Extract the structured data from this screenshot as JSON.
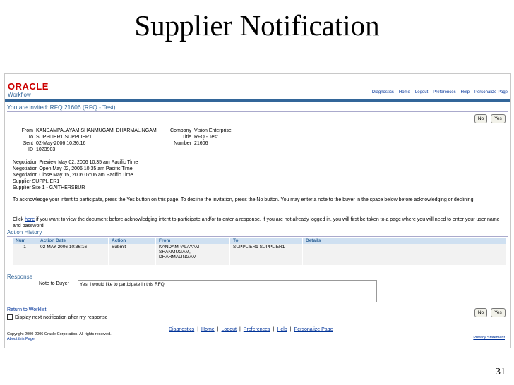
{
  "slide": {
    "title": "Supplier Notification",
    "number": "31"
  },
  "header": {
    "logo": "ORACLE",
    "brand": "Workflow",
    "links": [
      "Diagnostics",
      "Home",
      "Logout",
      "Preferences",
      "Help",
      "Personalize Page"
    ]
  },
  "page": {
    "title": "You are invited: RFQ 21606 (RFQ - Test)",
    "no_label": "No",
    "yes_label": "Yes"
  },
  "fields": {
    "from_label": "From",
    "from_value": "KANDAMPALAYAM SHANMUGAM, DHARMALINGAM",
    "to_label": "To",
    "to_value": "SUPPLIER1 SUPPLIER1",
    "sent_label": "Sent",
    "sent_value": "02-May-2006 10:36:16",
    "id_label": "ID",
    "id_value": "1023903",
    "company_label": "Company",
    "company_value": "Vision Enterprise",
    "title_label": "Title",
    "title_value": "RFQ - Test",
    "number_label": "Number",
    "number_value": "21606"
  },
  "negotiation": [
    "Negotiation Preview May 02, 2006 10:35 am Pacific Time",
    "Negotiation Open May 02, 2006 10:35 am Pacific Time",
    "Negotiation Close May 15, 2006 07:06 am Pacific Time",
    "Supplier SUPPLIER1",
    "Supplier Site 1 - GAITHERSBUR"
  ],
  "instructions": "To acknowledge your intent to participate, press the Yes button on this page. To decline the invitation, press the No button. You may enter a note to the buyer in the space below before acknowledging or declining.",
  "click_here": {
    "pre": "Click",
    "link": "here",
    "post": "if you want to view the document before acknowledging intent to participate and/or to enter a response. If you are not already logged in, you will first be taken to a page where you will need to enter your user name and password."
  },
  "action_history": {
    "title": "Action History",
    "columns": [
      "Num",
      "Action Date",
      "Action",
      "From",
      "To",
      "Details"
    ],
    "rows": [
      {
        "num": "1",
        "date": "02-MAY-2006 10:36:16",
        "action": "Submit",
        "from": "KANDAMPALAYAM SHANMUGAM, DHARMALINGAM",
        "to": "SUPPLIER1 SUPPLIER1",
        "details": ""
      }
    ]
  },
  "response": {
    "title": "Response",
    "note_label": "Note to Buyer",
    "note_value": "Yes, I would like to participate in this RFQ."
  },
  "footer": {
    "return_link": "Return to Worklist",
    "checkbox_label": "Display next notification after my response",
    "links": [
      "Diagnostics",
      "Home",
      "Logout",
      "Preferences",
      "Help",
      "Personalize Page"
    ],
    "copyright": "Copyright 2000-2006 Oracle Corporation. All rights reserved.",
    "about": "About this Page",
    "privacy": "Privacy Statement"
  }
}
